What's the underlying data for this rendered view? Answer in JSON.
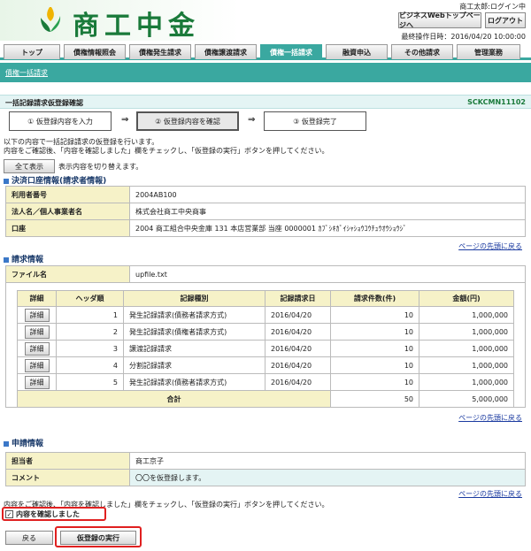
{
  "header": {
    "logo_text": "商工中金",
    "user_name": "商工太郎:ログイン中",
    "portal_button": "ビジネスWebトップページへ",
    "logout_button": "ログアウト",
    "last_operation": "最終操作日時：2016/04/20 10:00:00"
  },
  "tabs": [
    "トップ",
    "債権情報照会",
    "債権発生請求",
    "債権譲渡請求",
    "債権一括請求",
    "融資申込",
    "その他請求",
    "管理業務"
  ],
  "active_tab": 4,
  "subnav": {
    "link": "債権一括請求"
  },
  "page": {
    "title": "一括記録請求仮登録確認",
    "screen_id": "SCKCMN11102"
  },
  "steps": [
    "① 仮登録内容を入力",
    "② 仮登録内容を確認",
    "③ 仮登録完了"
  ],
  "arrow": "⇒",
  "instructions": [
    "以下の内容で一括記録請求の仮登録を行います。",
    "内容をご確認後、「内容を確認しました」欄をチェックし、「仮登録の実行」ボタンを押してください。"
  ],
  "show_all": {
    "button": "全て表示",
    "note": "表示内容を切り替えます。"
  },
  "account_section": {
    "title": "決済口座情報(請求者情報)",
    "rows": [
      {
        "label": "利用者番号",
        "value": "2004AB100"
      },
      {
        "label": "法人名／個人事業者名",
        "value": "株式会社商工中央商事"
      },
      {
        "label": "口座",
        "value": "2004 商工組合中央金庫 131 本店営業部 当座 0000001 ｶﾌﾞｼｷｶﾞｲｼｬｼｮｳｺｳﾁｭｳｵｳｼｮｳｼﾞ"
      }
    ]
  },
  "back_to_top": "ページの先頭に戻る",
  "request_section": {
    "title": "請求情報",
    "file_label": "ファイル名",
    "file_value": "upfile.txt",
    "columns": [
      "詳細",
      "ヘッダ順",
      "記録種別",
      "記録請求日",
      "請求件数(件)",
      "金額(円)"
    ],
    "detail_button": "詳細",
    "rows": [
      {
        "order": "1",
        "type": "発生記録請求(債務者請求方式)",
        "date": "2016/04/20",
        "count": "10",
        "amount": "1,000,000"
      },
      {
        "order": "2",
        "type": "発生記録請求(債権者請求方式)",
        "date": "2016/04/20",
        "count": "10",
        "amount": "1,000,000"
      },
      {
        "order": "3",
        "type": "譲渡記録請求",
        "date": "2016/04/20",
        "count": "10",
        "amount": "1,000,000"
      },
      {
        "order": "4",
        "type": "分割記録請求",
        "date": "2016/04/20",
        "count": "10",
        "amount": "1,000,000"
      },
      {
        "order": "5",
        "type": "発生記録請求(債務者請求方式)",
        "date": "2016/04/20",
        "count": "10",
        "amount": "1,000,000"
      }
    ],
    "total_label": "合計",
    "total_count": "50",
    "total_amount": "5,000,000"
  },
  "applicant_section": {
    "title": "申請情報",
    "rows": [
      {
        "label": "担当者",
        "value": "商工京子"
      },
      {
        "label": "コメント",
        "value": "〇〇を仮登録します。"
      }
    ]
  },
  "confirm": {
    "note": "内容をご確認後、「内容を確認しました」欄をチェックし、「仮登録の実行」ボタンを押してください。",
    "checkbox_label": "内容を確認しました",
    "checked_mark": "✓"
  },
  "footer": {
    "back_button": "戻る",
    "execute_button": "仮登録の実行"
  },
  "colors": {
    "accent": "#3aa8a0",
    "brand_green": "#1a7a3a",
    "label_bg": "#f6f2c8",
    "highlight": "#e02020"
  }
}
